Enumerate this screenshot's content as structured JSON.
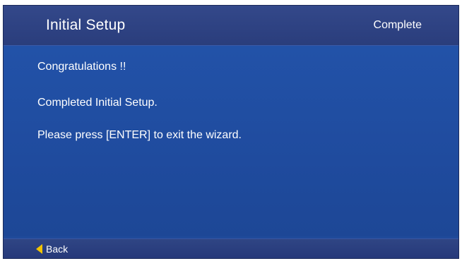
{
  "header": {
    "title": "Initial Setup",
    "status": "Complete"
  },
  "messages": {
    "line1": "Congratulations !!",
    "line2": "Completed Initial Setup.",
    "line3": "Please press [ENTER] to exit the wizard."
  },
  "footer": {
    "back_label": "Back",
    "back_icon": "triangle-left-icon",
    "back_icon_color": "#f2c400"
  },
  "colors": {
    "panel": "#1f4a9a",
    "header": "#2f4584"
  }
}
